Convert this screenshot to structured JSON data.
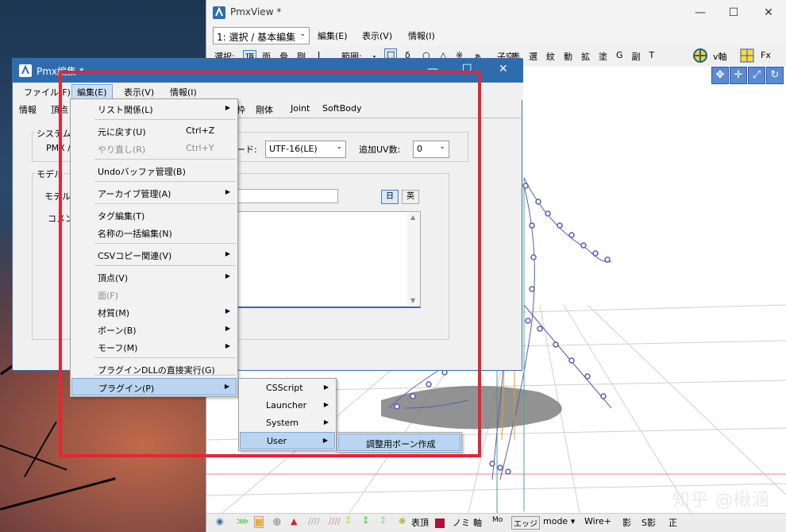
{
  "pmxview": {
    "title": "PmxView *",
    "mode_combo": "1: 選択 / 基本編集",
    "menu": [
      "編集(E)",
      "表示(V)",
      "情報(I)"
    ],
    "toolbar_sel_label": "選択:",
    "toolbar_sel_items": [
      "頂",
      "面",
      "骨",
      "剛",
      "J"
    ],
    "toolbar_range_label": "範囲:",
    "toolbar_range_items": [
      "・",
      "□",
      "δ",
      "○",
      "△",
      "※",
      "ぁ"
    ],
    "toolbar_child_label": "子空:",
    "toolbar_child_items": [
      "表",
      "選",
      "紋",
      "動",
      "拡",
      "塗",
      "G",
      "副",
      "T"
    ],
    "toolbar_v_axis": "v軸",
    "toolbar_fx": "Fx",
    "bottom": {
      "hyocho": "表頂",
      "no": "ノミ",
      "axis": "軸",
      "mo": "Mo",
      "edge": "エッジ",
      "mode": "mode ▾",
      "wire": "Wire+",
      "shadow": "影",
      "sshadow": "S影",
      "sei": "正"
    }
  },
  "pmxedit": {
    "title": "Pmx編集 *",
    "menu": [
      "ファイル(F)",
      "編集(E)",
      "表示(V)",
      "情報(I)"
    ],
    "tabs": [
      "情報",
      "頂点",
      "枠",
      "剛体",
      "Joint",
      "SoftBody"
    ],
    "group_system": "システム",
    "pmx_label": "PMX /",
    "encode_label": "ード:",
    "encode_value": "UTF-16(LE)",
    "uv_label": "追加UV数:",
    "uv_value": "0",
    "group_model": "モデル",
    "model_name_label": "モデル名",
    "comment_label": "コメント",
    "lang_jp": "日",
    "lang_en": "英"
  },
  "edit_menu": {
    "items": [
      {
        "label": "リスト関係(L)",
        "shortcut": "",
        "submenu": true,
        "disabled": false
      },
      {
        "label": "元に戻す(U)",
        "shortcut": "Ctrl+Z",
        "submenu": false,
        "disabled": false
      },
      {
        "label": "やり直し(R)",
        "shortcut": "Ctrl+Y",
        "submenu": false,
        "disabled": true
      },
      {
        "label": "Undoバッファ管理(B)",
        "shortcut": "",
        "submenu": false,
        "disabled": false
      },
      {
        "label": "アーカイブ管理(A)",
        "shortcut": "",
        "submenu": true,
        "disabled": false
      },
      {
        "label": "タグ編集(T)",
        "shortcut": "",
        "submenu": false,
        "disabled": false
      },
      {
        "label": "名称の一括編集(N)",
        "shortcut": "",
        "submenu": false,
        "disabled": false
      },
      {
        "label": "CSVコピー関連(V)",
        "shortcut": "",
        "submenu": true,
        "disabled": false
      },
      {
        "label": "頂点(V)",
        "shortcut": "",
        "submenu": true,
        "disabled": false
      },
      {
        "label": "面(F)",
        "shortcut": "",
        "submenu": false,
        "disabled": true
      },
      {
        "label": "材質(M)",
        "shortcut": "",
        "submenu": true,
        "disabled": false
      },
      {
        "label": "ボーン(B)",
        "shortcut": "",
        "submenu": true,
        "disabled": false
      },
      {
        "label": "モーフ(M)",
        "shortcut": "",
        "submenu": true,
        "disabled": false
      },
      {
        "label": "プラグインDLLの直接実行(G)",
        "shortcut": "",
        "submenu": false,
        "disabled": false
      },
      {
        "label": "プラグイン(P)",
        "shortcut": "",
        "submenu": true,
        "disabled": false
      }
    ]
  },
  "plugin_menu": {
    "items": [
      "CSScript",
      "Launcher",
      "System",
      "User"
    ]
  },
  "user_menu": {
    "items": [
      "調整用ボーン作成"
    ]
  },
  "watermark": "知乎 @楸涵",
  "colors": {
    "highlight": "#b9d5f2",
    "redbox": "#e32636",
    "title_active": "#2e6dad",
    "bones": "#5a5ab8"
  }
}
